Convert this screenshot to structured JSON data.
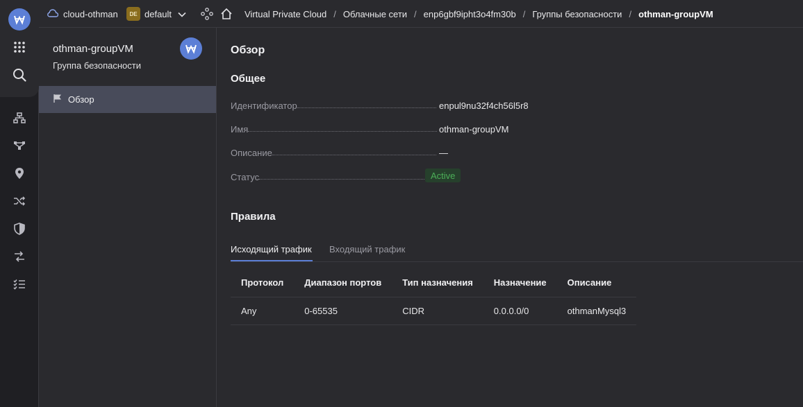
{
  "topbar": {
    "cloud_name": "cloud-othman",
    "folder_badge": "DE",
    "folder_name": "default",
    "breadcrumbs": [
      "Virtual Private Cloud",
      "Облачные сети",
      "enp6gbf9ipht3o4fm30b",
      "Группы безопасности",
      "othman-groupVM"
    ],
    "separator": "/"
  },
  "rail": {
    "icons": [
      "grid-icon",
      "search-icon",
      "network-icon",
      "topology-icon",
      "location-pin-icon",
      "shuffle-icon",
      "shield-icon",
      "route-icon",
      "checklist-icon"
    ],
    "accent": "#5c7fd6"
  },
  "sidebar": {
    "title": "othman-groupVM",
    "subtitle": "Группа безопасности",
    "nav_item": "Обзор"
  },
  "main": {
    "heading": "Обзор",
    "general_heading": "Общее",
    "props": [
      {
        "key": "Идентификатор",
        "value": "enpul9nu32f4ch56l5r8"
      },
      {
        "key": "Имя",
        "value": "othman-groupVM"
      },
      {
        "key": "Описание",
        "value": "—"
      },
      {
        "key": "Статус",
        "value": "Active"
      }
    ],
    "status_color": "#4caf58",
    "rules_heading": "Правила",
    "tabs": [
      "Исходящий трафик",
      "Входящий трафик"
    ],
    "active_tab": "Исходящий трафик",
    "table": {
      "columns": [
        "Протокол",
        "Диапазон портов",
        "Тип назначения",
        "Назначение",
        "Описание"
      ],
      "rows": [
        [
          "Any",
          "0-65535",
          "CIDR",
          "0.0.0.0/0",
          "othmanMysql3"
        ]
      ]
    }
  }
}
